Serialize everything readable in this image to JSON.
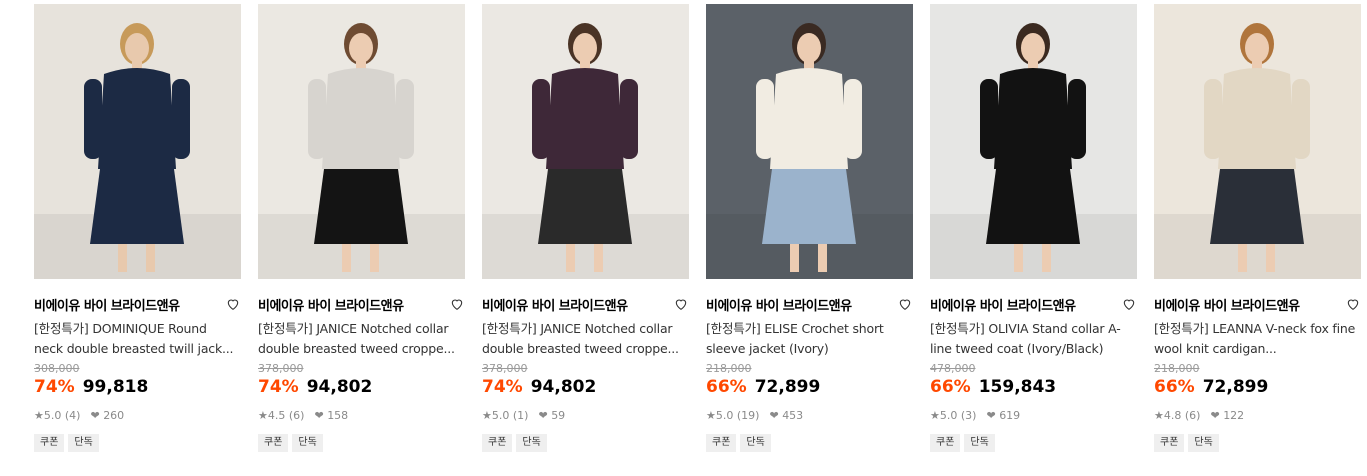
{
  "colors": {
    "discount": "#ff4800",
    "text": "#000000",
    "muted": "#8a8a8a"
  },
  "products": [
    {
      "brand": "비에이유 바이 브라이드앤유",
      "title": "[한정특가] DOMINIQUE Round neck double breasted twill jack...",
      "original_price": "308,000",
      "discount": "74%",
      "price": "99,818",
      "rating": "5.0",
      "reviews": "(4)",
      "likes": "260",
      "badges": [
        "쿠폰",
        "단독"
      ],
      "image": {
        "bg": "#e7e3dc",
        "garment": "#1c2a44",
        "garment2": "#1c2a44",
        "skin": "#e8c9ad",
        "hair": "#c79a5a"
      }
    },
    {
      "brand": "비에이유 바이 브라이드앤유",
      "title": "[한정특가] JANICE Notched collar double breasted tweed croppe...",
      "original_price": "378,000",
      "discount": "74%",
      "price": "94,802",
      "rating": "4.5",
      "reviews": "(6)",
      "likes": "158",
      "badges": [
        "쿠폰",
        "단독"
      ],
      "image": {
        "bg": "#ebe8e2",
        "garment": "#d7d4cf",
        "garment2": "#141414",
        "skin": "#ecccb2",
        "hair": "#6e4b32"
      }
    },
    {
      "brand": "비에이유 바이 브라이드앤유",
      "title": "[한정특가] JANICE Notched collar double breasted tweed croppe...",
      "original_price": "378,000",
      "discount": "74%",
      "price": "94,802",
      "rating": "5.0",
      "reviews": "(1)",
      "likes": "59",
      "badges": [
        "쿠폰",
        "단독"
      ],
      "image": {
        "bg": "#ebe8e3",
        "garment": "#3e2838",
        "garment2": "#2a2a2a",
        "skin": "#ecccb2",
        "hair": "#4a3325"
      }
    },
    {
      "brand": "비에이유 바이 브라이드앤유",
      "title": "[한정특가] ELISE Crochet short sleeve jacket (Ivory)",
      "original_price": "218,000",
      "discount": "66%",
      "price": "72,899",
      "rating": "5.0",
      "reviews": "(19)",
      "likes": "453",
      "badges": [
        "쿠폰",
        "단독"
      ],
      "image": {
        "bg": "#5b6168",
        "garment": "#f1ece2",
        "garment2": "#9bb3cc",
        "skin": "#ecccb2",
        "hair": "#3a2a22"
      }
    },
    {
      "brand": "비에이유 바이 브라이드앤유",
      "title": "[한정특가] OLIVIA Stand collar A-line tweed coat (Ivory/Black)",
      "original_price": "478,000",
      "discount": "66%",
      "price": "159,843",
      "rating": "5.0",
      "reviews": "(3)",
      "likes": "619",
      "badges": [
        "쿠폰",
        "단독"
      ],
      "image": {
        "bg": "#e6e6e4",
        "garment": "#121212",
        "garment2": "#121212",
        "skin": "#ecccb2",
        "hair": "#3b2a20"
      }
    },
    {
      "brand": "비에이유 바이 브라이드앤유",
      "title": "[한정특가] LEANNA V-neck fox fine wool knit cardigan...",
      "original_price": "218,000",
      "discount": "66%",
      "price": "72,899",
      "rating": "4.8",
      "reviews": "(6)",
      "likes": "122",
      "badges": [
        "쿠폰",
        "단독"
      ],
      "image": {
        "bg": "#ece6dc",
        "garment": "#e2d7c4",
        "garment2": "#2a2f38",
        "skin": "#ecccb2",
        "hair": "#b0753c"
      }
    }
  ]
}
